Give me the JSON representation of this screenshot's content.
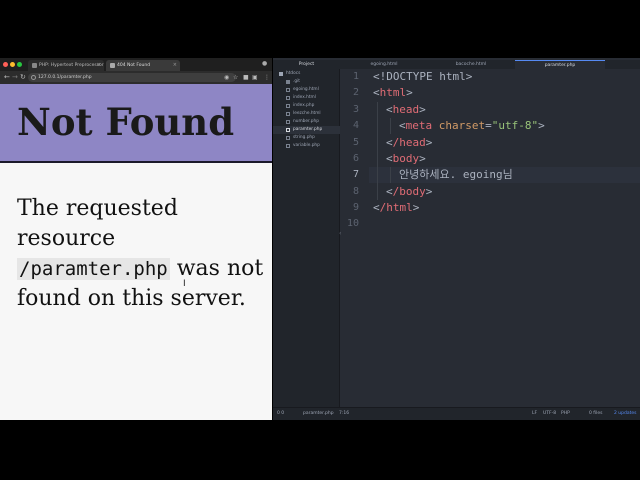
{
  "browser": {
    "tabs": [
      {
        "label": "PHP: Hypertext Preprocessor",
        "close": "×"
      },
      {
        "label": "404 Not Found",
        "close": "×"
      }
    ],
    "url": "127.0.0.1/paramter.php",
    "page": {
      "title": "Not Found",
      "body_before": "The requested resource ",
      "body_code": "/paramter.php",
      "body_after": " was not found on this server."
    }
  },
  "editor": {
    "tabs": [
      "Project",
      "egoing.html",
      "bacoche.html",
      "paramter.php"
    ],
    "tree": [
      {
        "label": "htdocs",
        "type": "folder-open"
      },
      {
        "label": ".git",
        "type": "folder"
      },
      {
        "label": "egoing.html",
        "type": "file"
      },
      {
        "label": "index.html",
        "type": "file"
      },
      {
        "label": "index.php",
        "type": "file"
      },
      {
        "label": "leezche.html",
        "type": "file"
      },
      {
        "label": "number.php",
        "type": "file"
      },
      {
        "label": "paramter.php",
        "type": "file",
        "selected": true
      },
      {
        "label": "string.php",
        "type": "file"
      },
      {
        "label": "variable.php",
        "type": "file"
      }
    ],
    "line_numbers": [
      "1",
      "2",
      "3",
      "4",
      "5",
      "6",
      "7",
      "8",
      "9",
      "10"
    ],
    "code": {
      "l1": "<!DOCTYPE html>",
      "l2_tag": "html",
      "l3_tag": "head",
      "l4_tag": "meta",
      "l4_attr": "charset",
      "l4_val": "\"utf-8\"",
      "l5_tag": "/head",
      "l6_tag": "body",
      "l7_text": "안녕하세요. egoing님",
      "l8_tag": "/body",
      "l9_tag": "/html"
    },
    "status": {
      "left_counts": "0  0",
      "file": "paramter.php",
      "cursor_pos": "7:16",
      "eol": "LF",
      "encoding": "UTF-8",
      "grammar": "PHP",
      "git_files": "0 files",
      "updates": "2 updates"
    }
  },
  "colors": {
    "header_bg": "#8e86c5",
    "editor_bg": "#282c34",
    "tag": "#e06c75",
    "attr": "#d19a66",
    "string": "#98c379"
  }
}
